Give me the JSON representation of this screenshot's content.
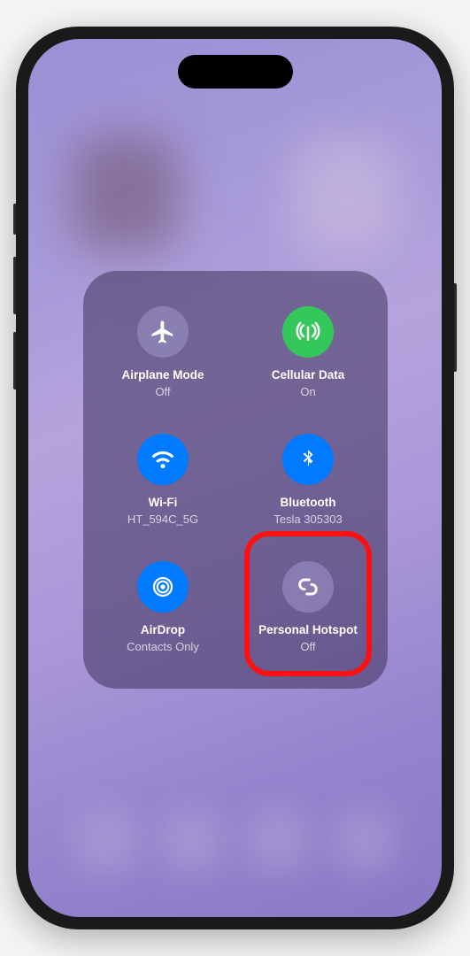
{
  "controls": {
    "airplane": {
      "title": "Airplane Mode",
      "status": "Off",
      "state": "off"
    },
    "cellular": {
      "title": "Cellular Data",
      "status": "On",
      "state": "green"
    },
    "wifi": {
      "title": "Wi-Fi",
      "status": "HT_594C_5G",
      "state": "blue"
    },
    "bluetooth": {
      "title": "Bluetooth",
      "status": "Tesla 305303",
      "state": "blue"
    },
    "airdrop": {
      "title": "AirDrop",
      "status": "Contacts Only",
      "state": "blue"
    },
    "hotspot": {
      "title": "Personal Hotspot",
      "status": "Off",
      "state": "off",
      "highlighted": true
    }
  }
}
